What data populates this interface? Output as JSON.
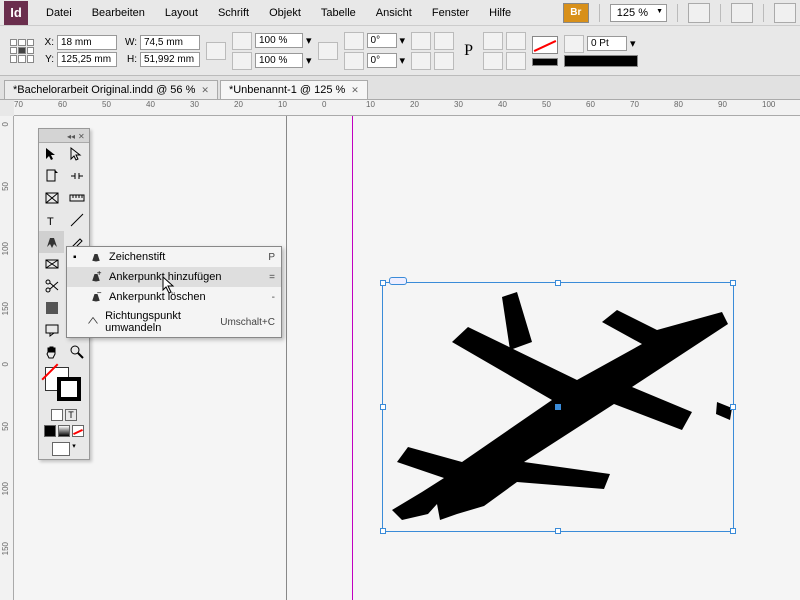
{
  "app": {
    "id_badge": "Id",
    "br_badge": "Br",
    "zoom": "125 %"
  },
  "menu": {
    "file": "Datei",
    "edit": "Bearbeiten",
    "layout": "Layout",
    "type": "Schrift",
    "object": "Objekt",
    "table": "Tabelle",
    "view": "Ansicht",
    "window": "Fenster",
    "help": "Hilfe"
  },
  "control": {
    "x": "18 mm",
    "y": "125,25 mm",
    "w": "74,5 mm",
    "h": "51,992 mm",
    "x_label": "X:",
    "y_label": "Y:",
    "w_label": "W:",
    "h_label": "H:",
    "scale_x": "100 %",
    "scale_y": "100 %",
    "rotate": "0°",
    "shear": "0°",
    "stroke_weight": "0 Pt"
  },
  "tabs": [
    {
      "title": "*Bachelorarbeit Original.indd @ 56 %",
      "active": false
    },
    {
      "title": "*Unbenannt-1 @ 125 %",
      "active": true
    }
  ],
  "ruler_h": [
    "70",
    "60",
    "50",
    "40",
    "30",
    "20",
    "10",
    "0",
    "10",
    "20",
    "30",
    "40",
    "50",
    "60",
    "70",
    "80",
    "90",
    "100"
  ],
  "ruler_v": [
    "0",
    "50",
    "100",
    "150",
    "0",
    "50",
    "100",
    "150"
  ],
  "flyout": {
    "items": [
      {
        "label": "Zeichenstift",
        "shortcut": "P",
        "checked": true
      },
      {
        "label": "Ankerpunkt hinzufügen",
        "shortcut": "=",
        "checked": false
      },
      {
        "label": "Ankerpunkt löschen",
        "shortcut": "-",
        "checked": false
      },
      {
        "label": "Richtungspunkt umwandeln",
        "shortcut": "Umschalt+C",
        "checked": false
      }
    ]
  }
}
